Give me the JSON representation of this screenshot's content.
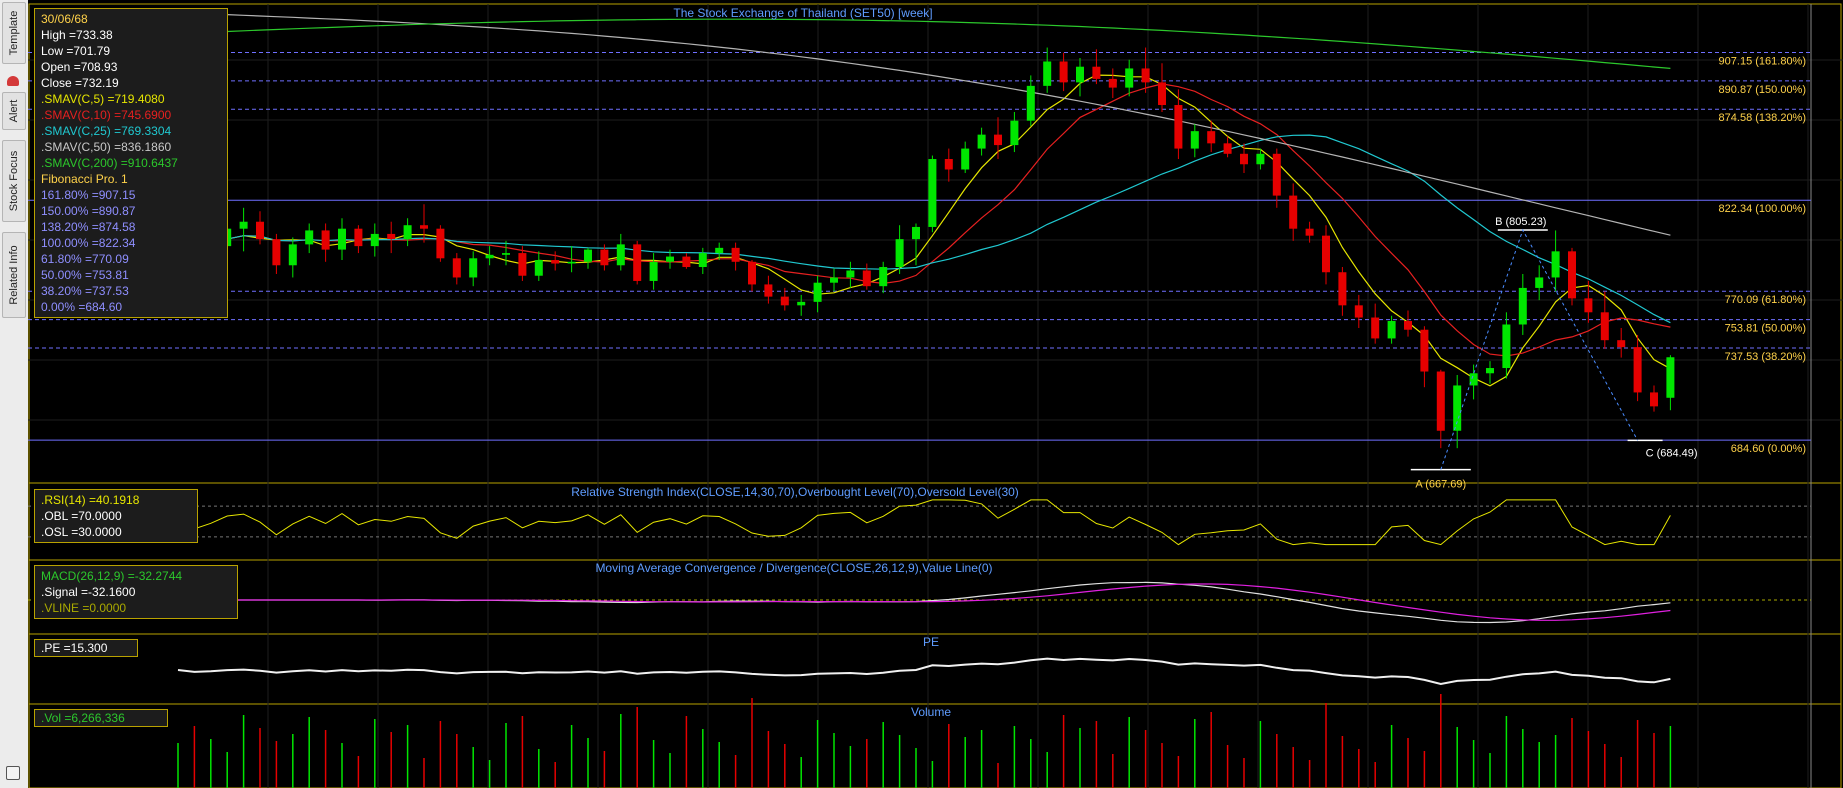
{
  "side_tabs": [
    {
      "label": "Template"
    },
    {
      "label": "Alert"
    },
    {
      "label": "Stock Focus"
    },
    {
      "label": "Related Info"
    }
  ],
  "main_panel": {
    "title": "The Stock Exchange of Thailand (SET50) [week]",
    "info": {
      "date": "30/06/68",
      "high": "High  =733.38",
      "low": "Low  =701.79",
      "open": "Open  =708.93",
      "close": "Close  =732.19",
      "smav5": ".SMAV(C,5)   =719.4080",
      "smav10": ".SMAV(C,10)  =745.6900",
      "smav25": ".SMAV(C,25)  =769.3304",
      "smav50": ".SMAV(C,50)  =836.1860",
      "smav200": ".SMAV(C,200)  =910.6437",
      "fib_title": "Fibonacci Pro. 1",
      "fib_lines": [
        "161.80% =907.15",
        "150.00% =890.87",
        "138.20% =874.58",
        "100.00% =822.34",
        "61.80% =770.09",
        "50.00% =753.81",
        "38.20% =737.53",
        "0.00% =684.60"
      ]
    },
    "fib_labels": [
      "907.15 (161.80%)",
      "890.87 (150.00%)",
      "874.58 (138.20%)",
      "822.34 (100.00%)",
      "770.09 (61.80%)",
      "753.81 (50.00%)",
      "737.53 (38.20%)",
      "684.60 (0.00%)"
    ],
    "point_labels": {
      "a": "A (667.69)",
      "b": "B (805.23)",
      "c": "C (684.49)"
    }
  },
  "rsi_panel": {
    "title": "Relative Strength Index(CLOSE,14,30,70),Overbought Level(70),Oversold Level(30)",
    "lines": [
      ".RSI(14)  =40.1918",
      ".OBL  =70.0000",
      ".OSL  =30.0000"
    ]
  },
  "macd_panel": {
    "title": "Moving Average Convergence / Divergence(CLOSE,26,12,9),Value Line(0)",
    "lines": [
      "MACD(26,12,9)  =-32.2744",
      ".Signal  =-32.1600",
      ".VLINE  =0.0000"
    ]
  },
  "pe_panel": {
    "title": "PE",
    "lines": [
      ".PE  =15.300"
    ]
  },
  "vol_panel": {
    "title": "Volume",
    "lines": [
      ".Vol  =6,266,336"
    ]
  },
  "colors": {
    "up": "#00e600",
    "down": "#e60000",
    "sma5": "#e6e600",
    "sma10": "#e62020",
    "sma25": "#20c8d0",
    "sma50": "#b4b4b4",
    "sma200": "#2cc82c",
    "fib": "#6f6fff",
    "panel_border": "#b9a200",
    "title": "#5f9cff"
  },
  "chart_data": {
    "type": "candlestick",
    "title": "The Stock Exchange of Thailand (SET50) [week]",
    "timeframe": "week",
    "last_bar": {
      "date": "30/06/68",
      "open": 708.93,
      "high": 733.38,
      "low": 701.79,
      "close": 732.19
    },
    "ylim": [
      660,
      935
    ],
    "candles": [
      [
        795,
        811,
        788,
        807
      ],
      [
        807,
        812,
        787,
        791
      ],
      [
        791,
        800,
        780,
        796
      ],
      [
        796,
        812,
        790,
        806
      ],
      [
        806,
        818,
        793,
        810
      ],
      [
        810,
        816,
        797,
        800
      ],
      [
        800,
        803,
        780,
        785
      ],
      [
        785,
        801,
        778,
        797
      ],
      [
        797,
        809,
        792,
        805
      ],
      [
        805,
        809,
        787,
        794
      ],
      [
        794,
        812,
        788,
        806
      ],
      [
        806,
        808,
        792,
        796
      ],
      [
        796,
        809,
        790,
        803
      ],
      [
        803,
        810,
        792,
        800
      ],
      [
        800,
        812,
        796,
        808
      ],
      [
        808,
        820,
        798,
        806
      ],
      [
        806,
        808,
        787,
        789
      ],
      [
        789,
        792,
        774,
        778
      ],
      [
        778,
        793,
        773,
        789
      ],
      [
        789,
        796,
        785,
        791
      ],
      [
        791,
        799,
        785,
        792
      ],
      [
        792,
        796,
        776,
        779
      ],
      [
        779,
        793,
        776,
        788
      ],
      [
        788,
        793,
        782,
        786
      ],
      [
        786,
        796,
        781,
        787
      ],
      [
        787,
        795,
        783,
        794
      ],
      [
        794,
        797,
        782,
        785
      ],
      [
        785,
        803,
        782,
        797
      ],
      [
        797,
        799,
        774,
        776
      ],
      [
        776,
        792,
        771,
        787
      ],
      [
        787,
        794,
        783,
        790
      ],
      [
        790,
        792,
        783,
        784
      ],
      [
        784,
        795,
        780,
        792
      ],
      [
        792,
        798,
        788,
        795
      ],
      [
        795,
        798,
        782,
        787
      ],
      [
        787,
        788,
        770,
        774
      ],
      [
        774,
        779,
        763,
        767
      ],
      [
        767,
        772,
        759,
        762
      ],
      [
        762,
        768,
        756,
        764
      ],
      [
        764,
        779,
        758,
        775
      ],
      [
        775,
        783,
        770,
        778
      ],
      [
        778,
        787,
        772,
        782
      ],
      [
        782,
        786,
        771,
        773
      ],
      [
        773,
        787,
        769,
        784
      ],
      [
        784,
        808,
        780,
        800
      ],
      [
        800,
        809,
        785,
        807
      ],
      [
        807,
        848,
        804,
        846
      ],
      [
        846,
        852,
        833,
        840
      ],
      [
        840,
        856,
        838,
        852
      ],
      [
        852,
        864,
        848,
        860
      ],
      [
        860,
        870,
        846,
        854
      ],
      [
        854,
        873,
        850,
        868
      ],
      [
        868,
        894,
        865,
        888
      ],
      [
        888,
        910,
        884,
        902
      ],
      [
        902,
        907,
        885,
        890
      ],
      [
        890,
        904,
        882,
        899
      ],
      [
        899,
        909,
        889,
        892
      ],
      [
        892,
        898,
        881,
        887
      ],
      [
        887,
        903,
        882,
        898
      ],
      [
        898,
        910,
        884,
        890
      ],
      [
        890,
        901,
        873,
        877
      ],
      [
        877,
        886,
        846,
        852
      ],
      [
        852,
        866,
        847,
        862
      ],
      [
        862,
        868,
        850,
        855
      ],
      [
        855,
        859,
        847,
        849
      ],
      [
        849,
        855,
        838,
        843
      ],
      [
        843,
        852,
        840,
        849
      ],
      [
        849,
        852,
        818,
        825
      ],
      [
        825,
        832,
        799,
        806
      ],
      [
        806,
        810,
        798,
        802
      ],
      [
        802,
        808,
        774,
        781
      ],
      [
        781,
        784,
        756,
        762
      ],
      [
        762,
        768,
        749,
        755
      ],
      [
        755,
        763,
        740,
        743
      ],
      [
        743,
        756,
        740,
        753
      ],
      [
        753,
        759,
        744,
        748
      ],
      [
        748,
        750,
        715,
        724
      ],
      [
        724,
        725,
        680,
        690
      ],
      [
        690,
        722,
        680,
        716
      ],
      [
        716,
        728,
        708,
        723
      ],
      [
        723,
        730,
        717,
        726
      ],
      [
        726,
        758,
        720,
        751
      ],
      [
        751,
        780,
        745,
        772
      ],
      [
        772,
        785,
        765,
        778
      ],
      [
        778,
        805,
        770,
        793
      ],
      [
        793,
        795,
        762,
        766
      ],
      [
        766,
        776,
        752,
        758
      ],
      [
        758,
        770,
        737,
        742
      ],
      [
        742,
        749,
        732,
        738
      ],
      [
        738,
        745,
        707,
        712
      ],
      [
        712,
        716,
        701,
        704
      ],
      [
        708.93,
        733.38,
        701.79,
        732.19
      ]
    ]
  }
}
